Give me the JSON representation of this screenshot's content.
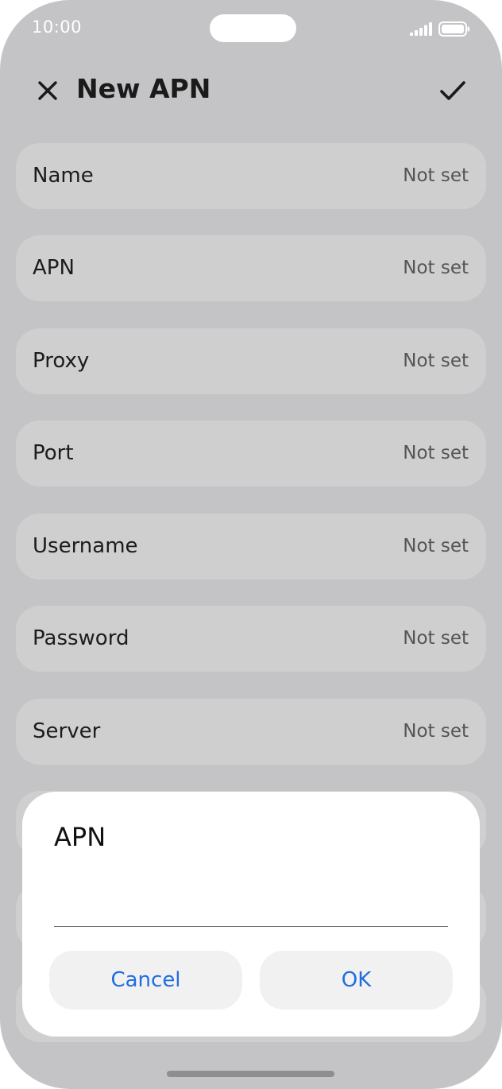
{
  "status_bar": {
    "time": "10:00"
  },
  "header": {
    "title": "New APN",
    "close_icon": "close-icon",
    "confirm_icon": "checkmark-icon"
  },
  "settings": [
    {
      "label": "Name",
      "value": "Not set"
    },
    {
      "label": "APN",
      "value": "Not set"
    },
    {
      "label": "Proxy",
      "value": "Not set"
    },
    {
      "label": "Port",
      "value": "Not set"
    },
    {
      "label": "Username",
      "value": "Not set"
    },
    {
      "label": "Password",
      "value": "Not set"
    },
    {
      "label": "Server",
      "value": "Not set"
    }
  ],
  "dialog": {
    "title": "APN",
    "input_value": "",
    "cancel_label": "Cancel",
    "ok_label": "OK"
  },
  "colors": {
    "overlay_background": "#c4c4c6",
    "row_background": "#cfcfcf",
    "accent": "#1f6ee0"
  }
}
